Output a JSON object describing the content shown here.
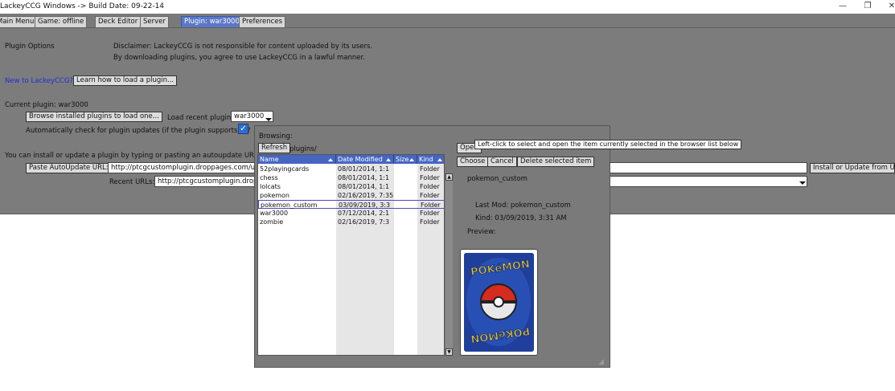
{
  "window": {
    "title": "LackeyCCG Windows -> Build Date: 09-22-14",
    "minimize": "—",
    "restore": "❐",
    "close": "✕"
  },
  "tabs": [
    {
      "label": "Main Menu",
      "active": false
    },
    {
      "label": "Game: offline",
      "active": false
    },
    {
      "label": "Deck Editor",
      "active": false
    },
    {
      "label": "Server",
      "active": false
    },
    {
      "label": "Plugin: war3000",
      "active": true
    },
    {
      "label": "Preferences",
      "active": false
    }
  ],
  "plugin_options": {
    "heading": "Plugin Options",
    "disclaimer_line1": "Disclaimer: LackeyCCG is not responsible for content uploaded by its users.",
    "disclaimer_line2": "By downloading plugins, you agree to use LackeyCCG in a lawful manner.",
    "new_to_label": "New to LackeyCCG?",
    "learn_button": "Learn how to load a plugin...",
    "current_plugin": "Current plugin: war3000",
    "browse_button": "Browse installed plugins to load one...",
    "load_recent_label": "Load recent plugin:",
    "load_recent_value": "war3000",
    "auto_check_label": "Automatically check for plugin updates (if the plugin supports it)?",
    "auto_check_checked": true,
    "install_text": "You can install or update a plugin by typing or pasting an autoupdate URL in th",
    "paste_button": "Paste AutoUpdate URL:",
    "url_value": "http://ptcgcustomplugin.droppages.com/up",
    "install_button": "Install or Update from UR",
    "recent_urls_label": "Recent URLs:",
    "recent_urls_value": "http://ptcgcustomplugin.drop"
  },
  "browser_dialog": {
    "browsing_label": "Browsing:",
    "refresh_button": "Refresh",
    "path": "plugins/",
    "open_button": "Open",
    "choose_button": "Choose",
    "cancel_button": "Cancel",
    "delete_button": "Delete selected item",
    "tooltip": "Left-click to select and open the item currently selected in the browser list below",
    "columns": [
      "Name",
      "Date Modified",
      "Size",
      "Kind"
    ],
    "rows": [
      {
        "name": "52playingcards",
        "date": "08/01/2014, 1:1",
        "size": "",
        "kind": "Folder"
      },
      {
        "name": "chess",
        "date": "08/01/2014, 1:1",
        "size": "",
        "kind": "Folder"
      },
      {
        "name": "lolcats",
        "date": "08/01/2014, 1:1",
        "size": "",
        "kind": "Folder"
      },
      {
        "name": "pokemon",
        "date": "02/16/2019, 7:35",
        "size": "",
        "kind": "Folder"
      },
      {
        "name": "pokemon_custom",
        "date": "03/09/2019, 3:3",
        "size": "",
        "kind": "Folder"
      },
      {
        "name": "war3000",
        "date": "07/12/2014, 2:1",
        "size": "",
        "kind": "Folder"
      },
      {
        "name": "zombie",
        "date": "02/16/2019, 7:3",
        "size": "",
        "kind": "Folder"
      }
    ],
    "selected_index": 4,
    "detail_name": "pokemon_custom",
    "last_mod": "Last Mod: pokemon_custom",
    "kind": "Kind: 03/09/2019, 3:31 AM",
    "preview_label": "Preview:",
    "preview_top_text": "POKéMON",
    "preview_bottom_text": "POKéMON"
  },
  "colors": {
    "panel_bg": "#7c7c7c",
    "active_tab": "#5b78c8",
    "list_header": "#4766c2",
    "link": "#1d2fd6",
    "card_back": "#1f3f9a",
    "card_text": "#f2c318"
  },
  "icons": {
    "checkmark": "✓",
    "scroll_up": "▲",
    "scroll_down": "▼",
    "resize_grip": "◢"
  }
}
